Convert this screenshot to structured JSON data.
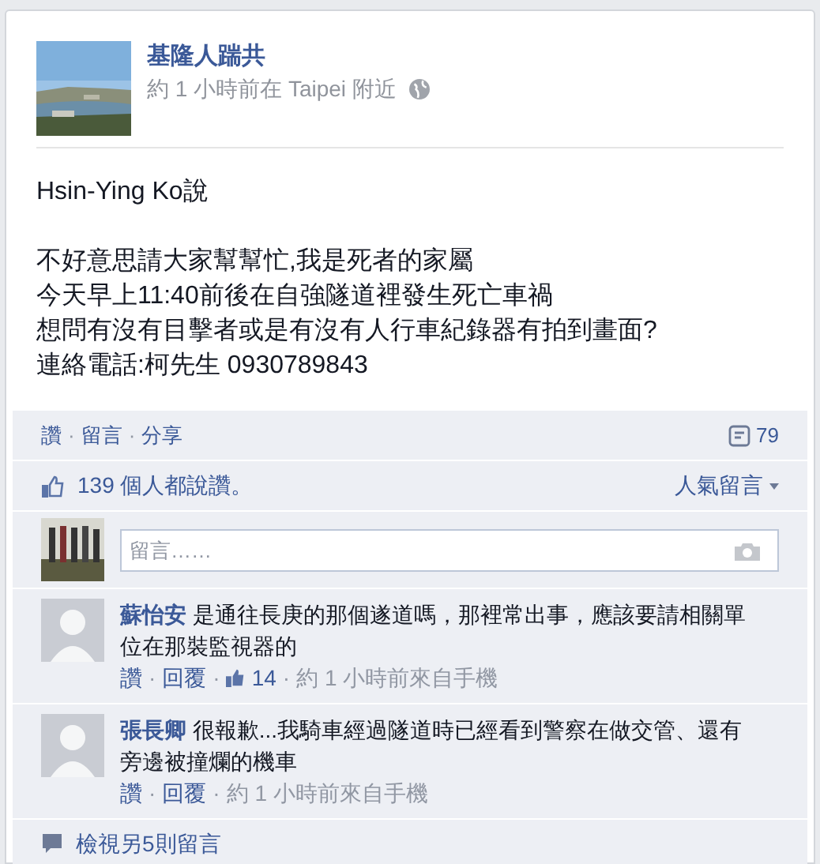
{
  "post": {
    "author": "基隆人踹共",
    "meta": "約 1 小時前在 Taipei 附近",
    "intro": "Hsin-Ying Ko說",
    "lines": [
      "不好意思請大家幫幫忙,我是死者的家屬",
      "今天早上11:40前後在自強隧道裡發生死亡車禍",
      "想問有沒有目擊者或是有沒有人行車紀錄器有拍到畫面?",
      "連絡電話:柯先生 0930789843"
    ]
  },
  "actions": {
    "items": [
      "讚",
      "留言",
      "分享"
    ],
    "separator": "·",
    "share_count": "79"
  },
  "likes": {
    "text": "139 個人都說讚。",
    "sort": "人氣留言"
  },
  "comment_box": {
    "placeholder": "留言……"
  },
  "comments": [
    {
      "author": "蘇怡安",
      "text": "是通往長庚的那個遂道嗎，那裡常出事，應該要請相關單位在那裝監視器的",
      "meta": [
        {
          "kind": "link",
          "text": "讚"
        },
        {
          "kind": "link",
          "text": "回覆"
        },
        {
          "kind": "likes",
          "text": "14"
        },
        {
          "kind": "time",
          "text": "約 1 小時前來自手機"
        }
      ]
    },
    {
      "author": "張長卿",
      "text": "很報歉...我騎車經過隧道時已經看到警察在做交管、還有旁邊被撞爛的機車",
      "meta": [
        {
          "kind": "link",
          "text": "讚"
        },
        {
          "kind": "link",
          "text": "回覆"
        },
        {
          "kind": "time",
          "text": "約 1 小時前來自手機"
        }
      ]
    }
  ],
  "more_comments": "檢視另5則留言"
}
